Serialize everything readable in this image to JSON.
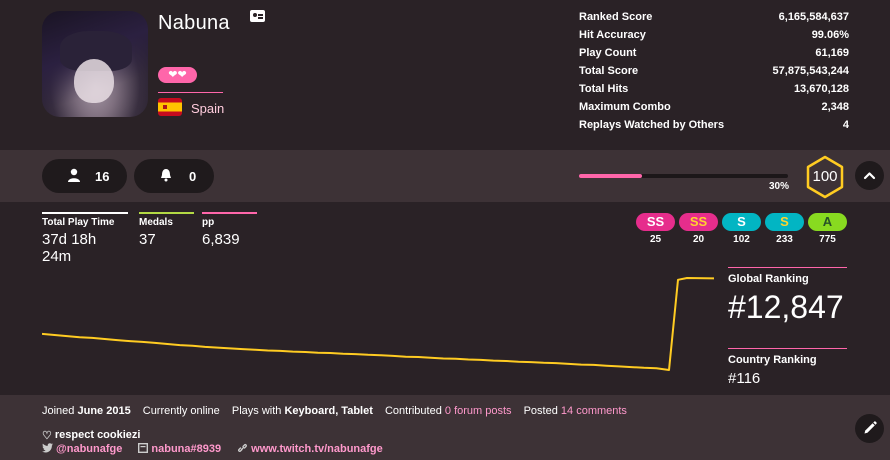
{
  "user": {
    "name": "Nabuna",
    "country": "Spain",
    "supporter_hearts": "❤❤"
  },
  "stats": [
    {
      "label": "Ranked Score",
      "value": "6,165,584,637"
    },
    {
      "label": "Hit Accuracy",
      "value": "99.06%"
    },
    {
      "label": "Play Count",
      "value": "61,169"
    },
    {
      "label": "Total Score",
      "value": "57,875,543,244"
    },
    {
      "label": "Total Hits",
      "value": "13,670,128"
    },
    {
      "label": "Maximum Combo",
      "value": "2,348"
    },
    {
      "label": "Replays Watched by Others",
      "value": "4"
    }
  ],
  "social": {
    "friends": "16",
    "followers": "0"
  },
  "level": {
    "progress_text": "30%",
    "progress_value": 0.3,
    "level": "100"
  },
  "summary": {
    "play_time_label": "Total Play Time",
    "play_time": "37d 18h 24m",
    "medals_label": "Medals",
    "medals": "37",
    "pp_label": "pp",
    "pp": "6,839"
  },
  "grades": [
    {
      "grade": "SS",
      "count": "25",
      "bg": "#e62d8c",
      "fg": "#ffffff"
    },
    {
      "grade": "SS",
      "count": "20",
      "bg": "#e62d8c",
      "fg": "#ffd32e"
    },
    {
      "grade": "S",
      "count": "102",
      "bg": "#02b5c3",
      "fg": "#ffffff"
    },
    {
      "grade": "S",
      "count": "233",
      "bg": "#02b5c3",
      "fg": "#ffd32e"
    },
    {
      "grade": "A",
      "count": "775",
      "bg": "#88da20",
      "fg": "#275227"
    }
  ],
  "ranking": {
    "global_label": "Global Ranking",
    "global": "#12,847",
    "country_label": "Country Ranking",
    "country": "#116"
  },
  "chart_data": {
    "type": "line",
    "description_values_note": "",
    "series": [
      {
        "values": [
          0.0,
          0.03,
          0.06,
          0.09,
          0.11,
          0.14,
          0.17,
          0.2,
          0.22,
          0.25,
          0.28,
          0.31,
          0.33,
          0.36,
          0.38,
          0.4,
          0.42,
          0.44,
          0.46,
          0.47,
          0.49,
          0.5,
          0.52,
          0.53,
          0.55,
          0.56,
          0.58,
          0.59,
          0.61,
          0.63,
          0.64,
          0.66,
          0.68,
          0.69,
          0.71,
          0.72,
          0.74,
          0.75,
          0.77,
          0.78,
          0.8,
          0.81,
          0.83,
          0.85,
          0.86,
          0.88,
          0.9,
          0.92,
          0.94,
          0.95,
          1.0,
          -1.5,
          -1.55,
          -1.54
        ]
      }
    ],
    "color": "#ffcc22"
  },
  "footer": {
    "joined_prefix": "Joined",
    "joined": "June 2015",
    "online": "Currently online",
    "plays_prefix": "Plays with",
    "plays_with": "Keyboard, Tablet",
    "contributed_prefix": "Contributed",
    "forum_posts": "0 forum posts",
    "posted_prefix": "Posted",
    "comments": "14 comments",
    "interests": "respect cookiezi",
    "twitter": "@nabunafge",
    "discord": "nabuna#8939",
    "website": "www.twitch.tv/nabunafge"
  }
}
